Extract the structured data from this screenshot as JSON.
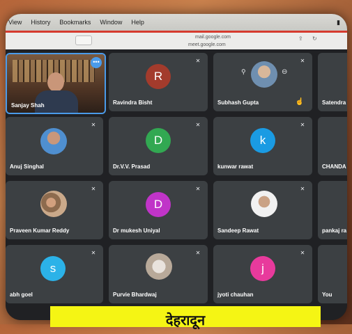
{
  "menubar": {
    "items": [
      "View",
      "History",
      "Bookmarks",
      "Window",
      "Help"
    ]
  },
  "address": {
    "url_primary": "mail.google.com",
    "url_secondary": "meet.google.com"
  },
  "participants": [
    {
      "name": "Sanjay Shah",
      "avatar": "photo",
      "muted": false,
      "self": true
    },
    {
      "name": "Ravindra Bisht",
      "initial": "R",
      "color": "#a33b2c",
      "muted": true
    },
    {
      "name": "Subhash Gupta",
      "avatar": "photo",
      "muted": true
    },
    {
      "name": "Satendra",
      "avatar": "none",
      "muted": false
    },
    {
      "name": "Anuj Singhal",
      "avatar": "photo",
      "muted": true
    },
    {
      "name": "Dr.V.V. Prasad",
      "initial": "D",
      "color": "#32a852",
      "muted": true
    },
    {
      "name": "kunwar rawat",
      "initial": "k",
      "color": "#1a9be3",
      "muted": true
    },
    {
      "name": "CHANDA",
      "avatar": "none",
      "muted": false
    },
    {
      "name": "Praveen Kumar Reddy",
      "avatar": "photo",
      "muted": true
    },
    {
      "name": "Dr mukesh Uniyal",
      "initial": "D",
      "color": "#c034c8",
      "muted": true
    },
    {
      "name": "Sandeep Rawat",
      "avatar": "photo",
      "muted": true
    },
    {
      "name": "pankaj ra",
      "avatar": "none",
      "muted": false
    },
    {
      "name": "abh goel",
      "initial": "s",
      "color": "#2bb2e8",
      "muted": true
    },
    {
      "name": "Purvie Bhardwaj",
      "avatar": "photo",
      "muted": true
    },
    {
      "name": "jyoti chauhan",
      "initial": "j",
      "color": "#e83a9c",
      "muted": true
    },
    {
      "name": "You",
      "avatar": "none",
      "muted": false
    }
  ],
  "banner": {
    "text": "देहरादून"
  }
}
